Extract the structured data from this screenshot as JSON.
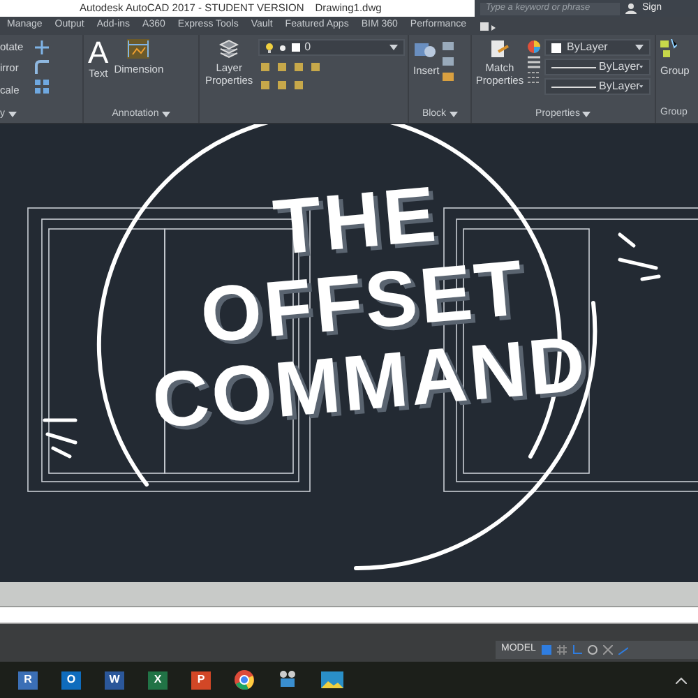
{
  "window": {
    "title": "Autodesk AutoCAD 2017 - STUDENT VERSION",
    "document": "Drawing1.dwg"
  },
  "search": {
    "placeholder": "Type a keyword or phrase"
  },
  "account": "Sign",
  "tabs": [
    "Manage",
    "Output",
    "Add-ins",
    "A360",
    "Express Tools",
    "Vault",
    "Featured Apps",
    "BIM 360",
    "Performance"
  ],
  "modify_tools": [
    "otate",
    "irror",
    "cale"
  ],
  "panels": [
    {
      "label": "y"
    },
    {
      "label": "Annotation"
    },
    {
      "label": "Block"
    },
    {
      "label": "Properties"
    },
    {
      "label": "Group"
    }
  ],
  "tools": {
    "text_glyph": "A",
    "text": "Text",
    "dimension": "Dimension",
    "layer_properties": "Layer Properties",
    "layer": "0",
    "insert": "Insert",
    "match_properties": "Match Properties",
    "group": "Group"
  },
  "properties": [
    "ByLayer",
    "ByLayer",
    "ByLayer"
  ],
  "overlay": {
    "lines": [
      "THE",
      "OFFSET",
      "COMMAND"
    ]
  },
  "status_bar": {
    "mode": "MODEL"
  },
  "taskbar": [
    {
      "letter": "R",
      "color": "#3b6fb6"
    },
    {
      "letter": "O",
      "color": "#0f6cbd"
    },
    {
      "letter": "W",
      "color": "#2b579a"
    },
    {
      "letter": "X",
      "color": "#217346"
    },
    {
      "letter": "P",
      "color": "#d24726"
    }
  ]
}
